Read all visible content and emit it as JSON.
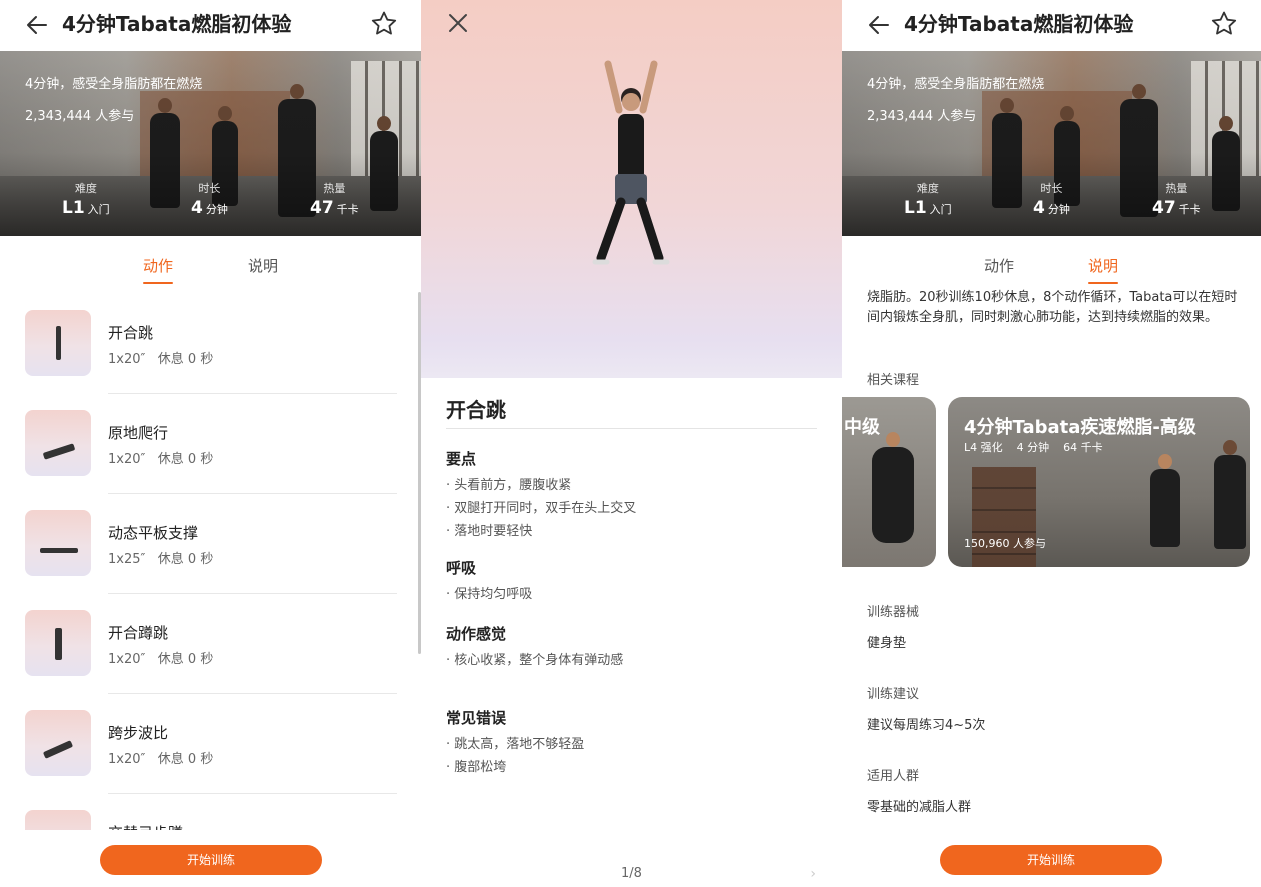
{
  "screen1": {
    "title": "4分钟Tabata燃脂初体验",
    "hero": {
      "subtitle": "4分钟，感受全身脂肪都在燃烧",
      "participants": "2,343,444 人参与",
      "stats": [
        {
          "label": "难度",
          "value": "L1",
          "unit": "入门"
        },
        {
          "label": "时长",
          "value": "4",
          "unit": "分钟"
        },
        {
          "label": "热量",
          "value": "47",
          "unit": "千卡"
        }
      ]
    },
    "tabs": [
      "动作",
      "说明"
    ],
    "exercises": [
      {
        "name": "开合跳",
        "duration": "1x20″",
        "rest": "休息 0 秒"
      },
      {
        "name": "原地爬行",
        "duration": "1x20″",
        "rest": "休息 0 秒"
      },
      {
        "name": "动态平板支撑",
        "duration": "1x25″",
        "rest": "休息 0 秒"
      },
      {
        "name": "开合蹲跳",
        "duration": "1x20″",
        "rest": "休息 0 秒"
      },
      {
        "name": "跨步波比",
        "duration": "1x20″",
        "rest": "休息 0 秒"
      },
      {
        "name": "交替弓步蹲",
        "duration": "",
        "rest": ""
      }
    ],
    "cta": "开始训练"
  },
  "screen2": {
    "exercise_name": "开合跳",
    "sections": [
      {
        "heading": "要点",
        "items": [
          "· 头看前方，腰腹收紧",
          "· 双腿打开同时，双手在头上交叉",
          "· 落地时要轻快"
        ]
      },
      {
        "heading": "呼吸",
        "items": [
          "· 保持均匀呼吸"
        ]
      },
      {
        "heading": "动作感觉",
        "items": [
          "· 核心收紧，整个身体有弹动感"
        ]
      },
      {
        "heading": "常见错误",
        "items": [
          "· 跳太高，落地不够轻盈",
          "· 腹部松垮"
        ]
      }
    ],
    "pager": "1/8",
    "next_glyph": "›"
  },
  "screen3": {
    "title": "4分钟Tabata燃脂初体验",
    "hero": {
      "subtitle": "4分钟，感受全身脂肪都在燃烧",
      "participants": "2,343,444 人参与",
      "stats": [
        {
          "label": "难度",
          "value": "L1",
          "unit": "入门"
        },
        {
          "label": "时长",
          "value": "4",
          "unit": "分钟"
        },
        {
          "label": "热量",
          "value": "47",
          "unit": "千卡"
        }
      ]
    },
    "tabs": [
      "动作",
      "说明"
    ],
    "description": "烧脂肪。20秒训练10秒休息，8个动作循环，Tabata可以在短时间内锻炼全身肌，同时刺激心肺功能，达到持续燃脂的效果。",
    "related_label": "相关课程",
    "related_courses": [
      {
        "title_fragment": "中级"
      },
      {
        "title": "4分钟Tabata疾速燃脂-高级",
        "level": "L4 强化",
        "duration": "4 分钟",
        "calories": "64 千卡",
        "participants": "150,960 人参与"
      }
    ],
    "info": [
      {
        "label": "训练器械",
        "value": "健身垫"
      },
      {
        "label": "训练建议",
        "value": "建议每周练习4~5次"
      },
      {
        "label": "适用人群",
        "value": "零基础的减脂人群"
      }
    ],
    "cta": "开始训练"
  },
  "colors": {
    "accent": "#f0661e",
    "text": "#222222",
    "muted": "#666666"
  }
}
